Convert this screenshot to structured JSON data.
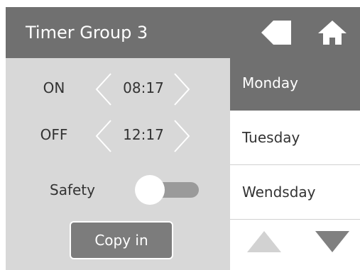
{
  "header": {
    "title": "Timer Group 3",
    "back_icon": "arrow-left-icon",
    "home_icon": "home-icon",
    "background": "#707070"
  },
  "timer": {
    "on": {
      "label": "ON",
      "value": "08:17"
    },
    "off": {
      "label": "OFF",
      "value": "12:17"
    },
    "safety": {
      "label": "Safety",
      "enabled": false
    }
  },
  "copy_button": {
    "label": "Copy in"
  },
  "days": {
    "items": [
      {
        "label": "Monday",
        "selected": true
      },
      {
        "label": "Tuesday",
        "selected": false
      },
      {
        "label": "Wendsday",
        "selected": false
      }
    ]
  },
  "nav": {
    "up_icon": "triangle-up-icon",
    "down_icon": "triangle-down-icon"
  },
  "colors": {
    "panel": "#d8d8d8",
    "selected_day": "#707070",
    "accent_gray": "#7c7c7c"
  }
}
